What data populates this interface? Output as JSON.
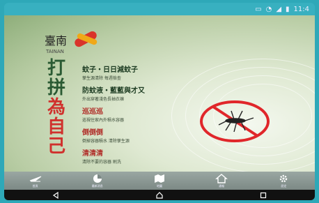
{
  "status_bar": {
    "icons": [
      "cast-icon",
      "wifi-icon",
      "signal-icon",
      "battery-icon"
    ],
    "time": "11:4"
  },
  "poster": {
    "logo_text": "臺南",
    "logo_sub": "TAINAN",
    "vertical_title": [
      "打",
      "拼",
      "為",
      "自",
      "己"
    ],
    "lines": [
      {
        "head": "蚊子・日日減蚊子",
        "sub": "孳生源清除 每週檢查",
        "red": false
      },
      {
        "head": "防蚊液・藍藍與才又",
        "sub": "外出穿著淺色長袖衣褲",
        "red": false
      },
      {
        "head": "巡巡巡",
        "sub": "巡視住家內外積水容器",
        "red": true
      },
      {
        "head": "倒倒倒",
        "sub": "倒掉容器積水 清除孳生源",
        "red": true
      },
      {
        "head": "清清清",
        "sub": "清除不要的容器 刷洗",
        "red": true
      }
    ],
    "prohibition_icon": "no-mosquito-icon"
  },
  "tabs": [
    {
      "name": "tab-home",
      "icon": "plane-icon",
      "label": "首頁"
    },
    {
      "name": "tab-news",
      "icon": "chart-icon",
      "label": "最新消息"
    },
    {
      "name": "tab-map",
      "icon": "map-icon",
      "label": "地圖"
    },
    {
      "name": "tab-report",
      "icon": "house-icon",
      "label": "通報"
    },
    {
      "name": "tab-settings",
      "icon": "gear-icon",
      "label": "設定"
    }
  ],
  "nav": {
    "buttons": [
      "back-icon",
      "home-icon",
      "recents-icon"
    ]
  },
  "colors": {
    "frame": "#2ba4b4",
    "accent_red": "#d0312d",
    "dark_green": "#2a5a33"
  }
}
